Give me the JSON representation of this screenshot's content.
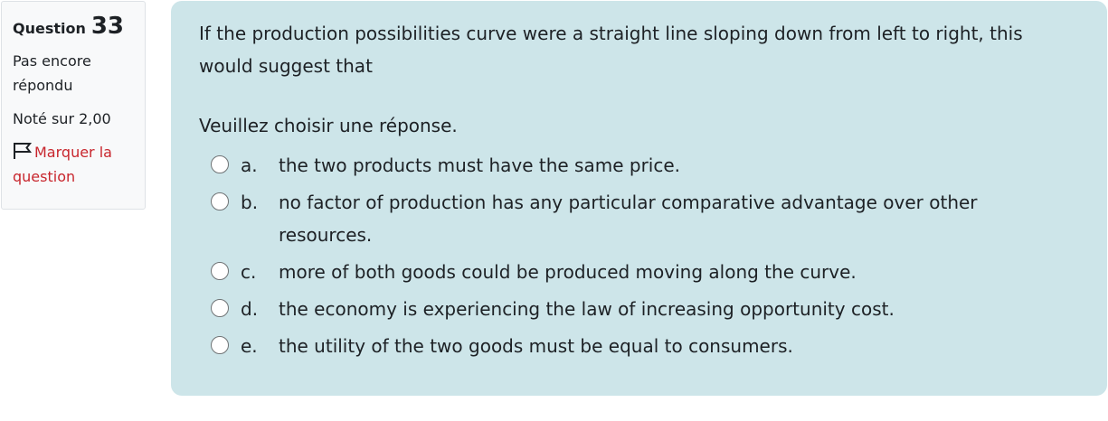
{
  "info": {
    "question_label": "Question",
    "question_number": "33",
    "status": "Pas encore répondu",
    "mark": "Noté sur 2,00",
    "flag_label": "Marquer la question"
  },
  "question": {
    "text": "If the production possibilities curve were a straight line sloping down from left to right, this would suggest that",
    "prompt": "Veuillez choisir une réponse.",
    "answers": [
      {
        "letter": "a.",
        "text": "the two products must have the same price."
      },
      {
        "letter": "b.",
        "text": "no factor of production has any particular comparative advantage over other resources."
      },
      {
        "letter": "c.",
        "text": "more of both goods could be produced moving along the curve."
      },
      {
        "letter": "d.",
        "text": "the economy is experiencing the law of increasing opportunity cost."
      },
      {
        "letter": "e.",
        "text": "the utility of the two goods must be equal to consumers."
      }
    ]
  },
  "colors": {
    "content_background": "#cde5e9",
    "info_background": "#f8f9fa",
    "flag_link": "#c8262d"
  },
  "icons": {
    "flag": "flag-outline-icon",
    "radio": "radio-unchecked"
  }
}
